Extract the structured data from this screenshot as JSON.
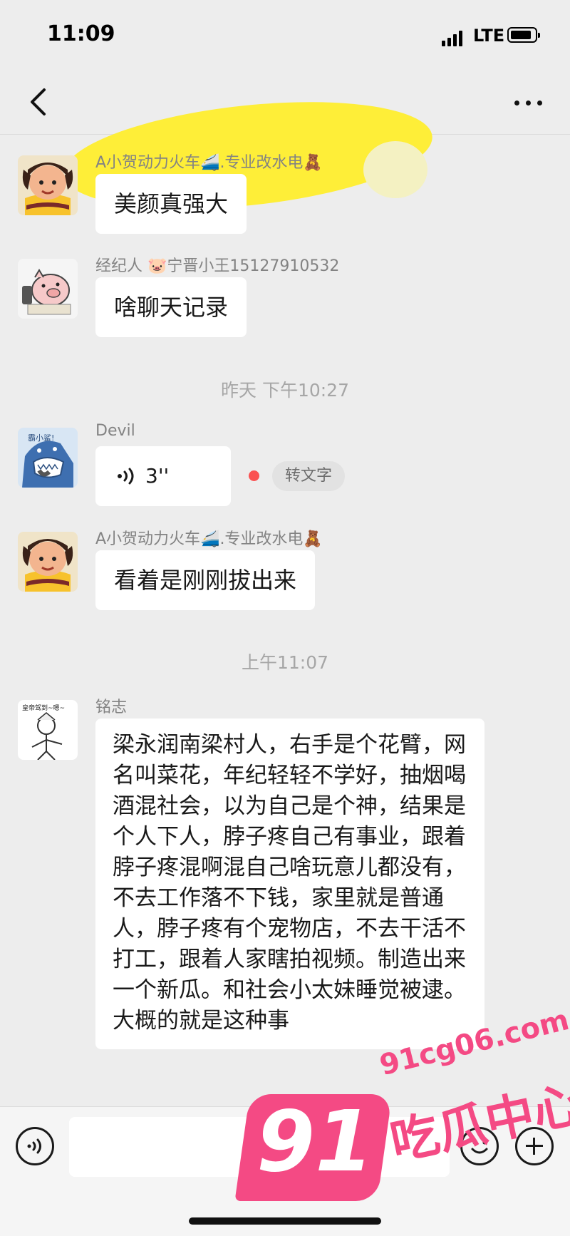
{
  "status_bar": {
    "time": "11:09",
    "network": "LTE"
  },
  "messages": [
    {
      "sender": "A小贺动力火车🚄.专业改水电🧸",
      "text": "美颜真强大"
    },
    {
      "sender": "经纪人 🐷宁晋小王15127910532",
      "text": "啥聊天记录"
    },
    {
      "timestamp": "昨天 下午10:27"
    },
    {
      "sender": "Devil",
      "voice_duration": "3''",
      "transcribe_label": "转文字"
    },
    {
      "sender": "A小贺动力火车🚄.专业改水电🧸",
      "text": "看着是刚刚拔出来"
    },
    {
      "timestamp": "上午11:07"
    },
    {
      "sender": "铭志",
      "avatar_caption": "皇帝驾到~嗯~",
      "text": "梁永润南梁村人，右手是个花臂，网名叫菜花，年纪轻轻不学好，抽烟喝酒混社会，以为自己是个神，结果是个人下人，脖子疼自己有事业，跟着脖子疼混啊混自己啥玩意儿都没有，不去工作落不下钱，家里就是普通人，脖子疼有个宠物店，不去干活不打工，跟着人家瞎拍视频。制造出来一个新瓜。和社会小太妹睡觉被逮。大概的就是这种事"
    }
  ],
  "avatar3_caption": "霸小鲨!",
  "watermark": {
    "url": "91cg06.com",
    "number": "91",
    "name": "吃瓜中心"
  }
}
